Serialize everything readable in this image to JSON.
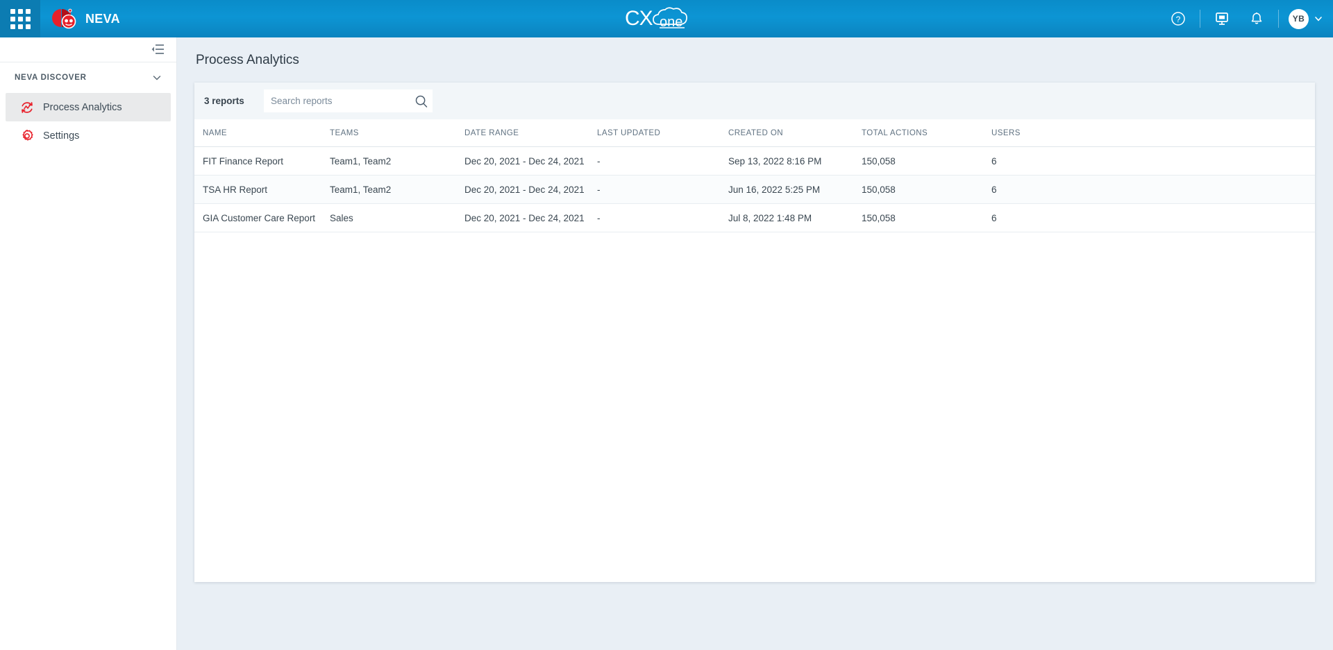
{
  "header": {
    "app_grid_icon": "apps-grid-icon",
    "brand_name": "NEVA",
    "brand_logo_icon": "neva-robot-logo",
    "center_logo": "CXone",
    "center_logo_icon": "cxone-cloud-logo",
    "help_icon": "help-circle-icon",
    "dashboard_icon": "presentation-monitor-icon",
    "notifications_icon": "bell-icon",
    "avatar_initials": "YB",
    "avatar_chevron_icon": "chevron-down-icon"
  },
  "sidebar": {
    "collapse_icon": "collapse-panel-icon",
    "section": {
      "label": "NEVA DISCOVER",
      "chevron_icon": "chevron-down-icon"
    },
    "items": [
      {
        "label": "Process Analytics",
        "icon": "process-analytics-icon",
        "active": true
      },
      {
        "label": "Settings",
        "icon": "gear-icon",
        "active": false
      }
    ]
  },
  "main": {
    "page_title": "Process Analytics",
    "toolbar": {
      "reports_count": "3 reports",
      "search_placeholder": "Search reports",
      "search_value": "",
      "search_icon": "search-icon"
    },
    "table": {
      "columns": [
        "NAME",
        "TEAMS",
        "DATE RANGE",
        "LAST UPDATED",
        "CREATED ON",
        "TOTAL ACTIONS",
        "USERS"
      ],
      "rows": [
        {
          "name": "FIT Finance Report",
          "teams": "Team1, Team2",
          "date_range": "Dec 20, 2021 - Dec 24, 2021",
          "last_updated": "-",
          "created_on": "Sep 13, 2022 8:16 PM",
          "total_actions": "150,058",
          "users": "6"
        },
        {
          "name": "TSA HR Report",
          "teams": "Team1, Team2",
          "date_range": "Dec 20, 2021 - Dec 24, 2021",
          "last_updated": "-",
          "created_on": "Jun 16, 2022 5:25 PM",
          "total_actions": "150,058",
          "users": "6"
        },
        {
          "name": "GIA Customer Care Report",
          "teams": "Sales",
          "date_range": "Dec 20, 2021 - Dec 24, 2021",
          "last_updated": "-",
          "created_on": "Jul 8, 2022 1:48 PM",
          "total_actions": "150,058",
          "users": "6"
        }
      ]
    }
  },
  "colors": {
    "header_blue": "#0c95d4",
    "accent_red": "#e8202a",
    "page_bg": "#e9eff5",
    "card_bg": "#f2f6f9",
    "text_dark": "#3a4751",
    "text_muted": "#5f7181"
  }
}
